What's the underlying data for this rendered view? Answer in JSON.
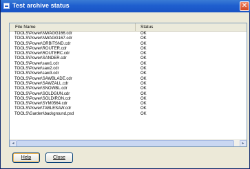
{
  "window": {
    "title": "Test archive status",
    "close_glyph": "✕"
  },
  "list": {
    "columns": [
      "File Name",
      "Status"
    ],
    "rows": [
      {
        "file": "TOOLS\\Power\\NWAGG166.cdr",
        "status": "OK"
      },
      {
        "file": "TOOLS\\Power\\NWAGG167.cdr",
        "status": "OK"
      },
      {
        "file": "TOOLS\\Power\\ORBITSND.cdr",
        "status": "OK"
      },
      {
        "file": "TOOLS\\Power\\ROUTER.cdr",
        "status": "OK"
      },
      {
        "file": "TOOLS\\Power\\ROUTERC.cdr",
        "status": "OK"
      },
      {
        "file": "TOOLS\\Power\\SANDER.cdr",
        "status": "OK"
      },
      {
        "file": "TOOLS\\Power\\saw1.cdr",
        "status": "OK"
      },
      {
        "file": "TOOLS\\Power\\saw2.cdr",
        "status": "OK"
      },
      {
        "file": "TOOLS\\Power\\saw3.cdr",
        "status": "OK"
      },
      {
        "file": "TOOLS\\Power\\SAWBLADE.cdr",
        "status": "OK"
      },
      {
        "file": "TOOLS\\Power\\SAWZALL.cdr",
        "status": "OK"
      },
      {
        "file": "TOOLS\\Power\\SNOWBL.cdr",
        "status": "OK"
      },
      {
        "file": "TOOLS\\Power\\SOLDGUN.cdr",
        "status": "OK"
      },
      {
        "file": "TOOLS\\Power\\SOLDIRON.cdr",
        "status": "OK"
      },
      {
        "file": "TOOLS\\Power\\SYM0564.cdr",
        "status": "OK"
      },
      {
        "file": "TOOLS\\Power\\TABLESAW.cdr",
        "status": "OK"
      },
      {
        "file": "TOOLS\\Garden\\background.psd",
        "status": "OK"
      }
    ]
  },
  "scrollbar": {
    "left_glyph": "◂",
    "right_glyph": "▸"
  },
  "buttons": {
    "help": "Help",
    "close": "Close"
  }
}
